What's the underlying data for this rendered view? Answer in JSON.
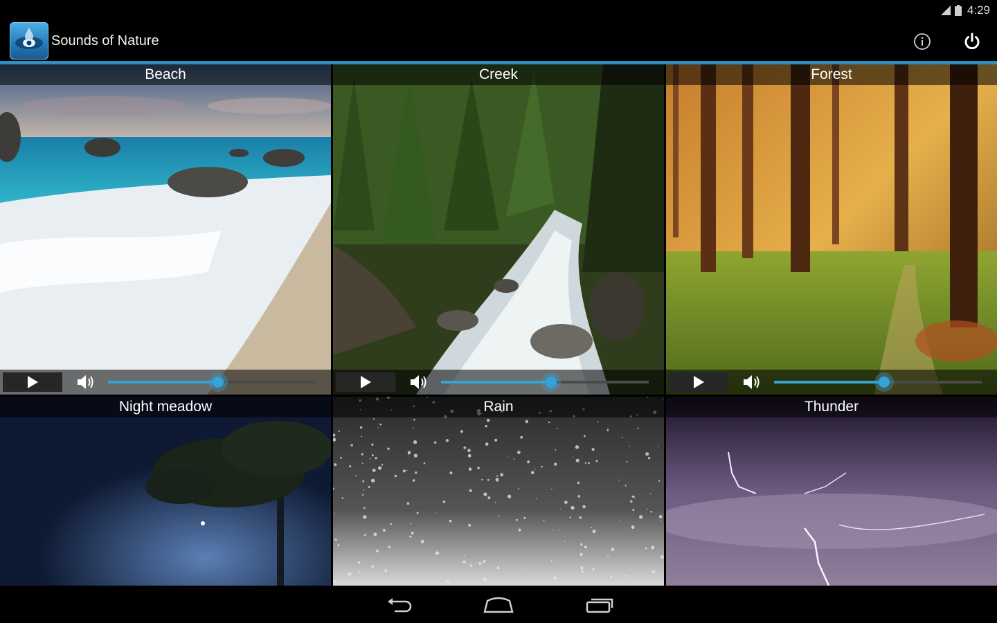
{
  "status_bar": {
    "time": "4:29",
    "signal_icon": "signal-icon",
    "battery_icon": "battery-icon"
  },
  "action_bar": {
    "app_title": "Sounds of Nature",
    "app_icon": "water-drop-eye-icon",
    "info_icon": "info-icon",
    "power_icon": "power-icon",
    "accent_color": "#2f8fbf"
  },
  "sounds": [
    {
      "name": "Beach",
      "volume": 0.53,
      "playing": false
    },
    {
      "name": "Creek",
      "volume": 0.53,
      "playing": false
    },
    {
      "name": "Forest",
      "volume": 0.53,
      "playing": false
    },
    {
      "name": "Night meadow"
    },
    {
      "name": "Rain"
    },
    {
      "name": "Thunder"
    }
  ],
  "nav_bar": {
    "back_icon": "back-icon",
    "home_icon": "home-icon",
    "recents_icon": "recent-apps-icon"
  }
}
